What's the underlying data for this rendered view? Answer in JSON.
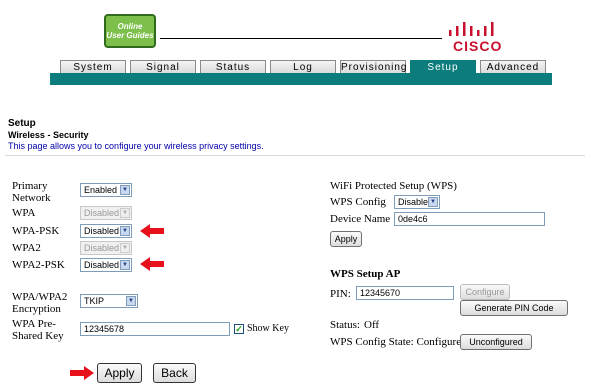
{
  "header": {
    "guides_logo": [
      "Online",
      "User Guides"
    ],
    "brand": "CISCO",
    "tabs": [
      {
        "label": "System",
        "active": false
      },
      {
        "label": "Signal",
        "active": false
      },
      {
        "label": "Status",
        "active": false
      },
      {
        "label": "Log",
        "active": false
      },
      {
        "label": "Provisioning",
        "active": false
      },
      {
        "label": "Setup",
        "active": true
      },
      {
        "label": "Advanced",
        "active": false
      }
    ],
    "accent_color": "#0d7c7c",
    "brand_color": "#c8102e"
  },
  "section": {
    "title": "Setup",
    "subtitle": "Wireless - Security",
    "description": "This page allows you to configure your wireless privacy settings."
  },
  "security": {
    "primary_network_label_1": "Primary",
    "primary_network_label_2": "Network",
    "primary_network_value": "Enabled",
    "wpa_label": "WPA",
    "wpa_value": "Disabled",
    "wpa_psk_label": "WPA-PSK",
    "wpa_psk_value": "Disabled",
    "wpa2_label": "WPA2",
    "wpa2_value": "Disabled",
    "wpa2_psk_label": "WPA2-PSK",
    "wpa2_psk_value": "Disabled",
    "encryption_label_1": "WPA/WPA2",
    "encryption_label_2": "Encryption",
    "encryption_value": "TKIP",
    "psk_label_1": "WPA Pre-",
    "psk_label_2": "Shared Key",
    "psk_value": "12345678",
    "show_key_label": "Show Key",
    "show_key_checked": true
  },
  "wps": {
    "title": "WiFi Protected Setup (WPS)",
    "config_label": "WPS Config",
    "config_value": "Disable",
    "device_name_label": "Device Name",
    "device_name_value": "0de4c6",
    "apply_label": "Apply",
    "setup_ap_title": "WPS Setup AP",
    "pin_label": "PIN:",
    "pin_value": "12345670",
    "configure_label": "Configure",
    "generate_pin_label": "Generate PIN Code",
    "status_label": "Status:",
    "status_value": "Off",
    "config_state_label": "WPS Config State: Configured",
    "unconfigured_label": "Unconfigured"
  },
  "footer": {
    "apply_label": "Apply",
    "back_label": "Back"
  },
  "arrow_color": "#e8101a"
}
